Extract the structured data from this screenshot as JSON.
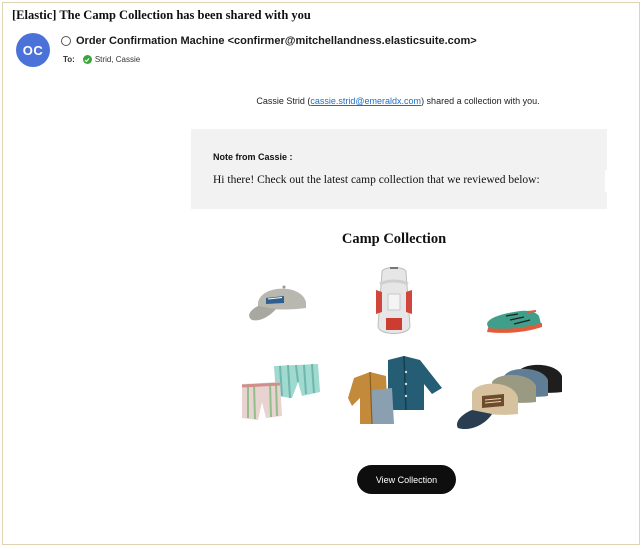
{
  "email": {
    "subject": "[Elastic] The Camp Collection has been shared with you",
    "avatar_initials": "OC",
    "avatar_color": "#4a72d9",
    "sender": "Order Confirmation Machine <confirmer@mitchellandness.elasticsuite.com>",
    "to_label": "To:",
    "recipient": "Strid, Cassie"
  },
  "body": {
    "sharer_name": "Cassie Strid (",
    "sharer_email": "cassie.strid@emeraldx.com",
    "share_suffix": ") shared a collection with you.",
    "note_title": "Note from Cassie :",
    "note_text": "Hi there! Check out the latest camp collection that we reviewed below:",
    "collection_title": "Camp Collection",
    "products": [
      {
        "name": "grey cap",
        "icon": "cap-icon"
      },
      {
        "name": "white backpack",
        "icon": "backpack-icon"
      },
      {
        "name": "trail shoe",
        "icon": "shoe-icon"
      },
      {
        "name": "striped shorts",
        "icon": "shorts-icon"
      },
      {
        "name": "shirt jackets",
        "icon": "jacket-icon"
      },
      {
        "name": "trucker caps",
        "icon": "trucker-caps-icon"
      }
    ],
    "button_label": "View Collection"
  },
  "colors": {
    "link": "#1a6fc9",
    "button_bg": "#0e0e0e",
    "note_bg": "#f2f2f2",
    "border": "#e0d3b3"
  }
}
